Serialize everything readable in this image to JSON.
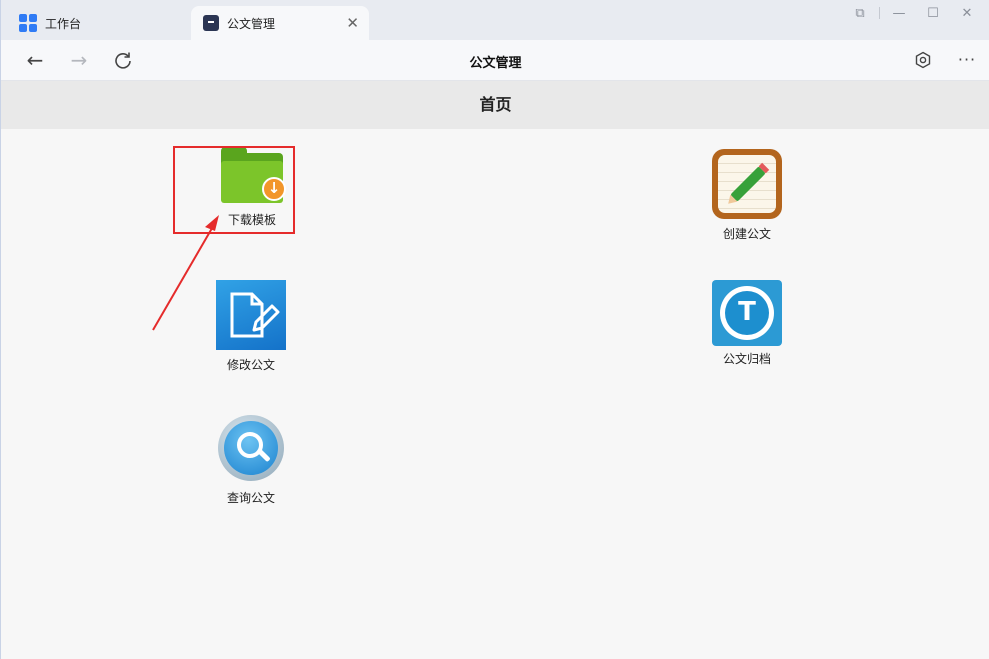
{
  "tabs": [
    {
      "label": "工作台",
      "icon": "workbench-grid-icon"
    },
    {
      "label": "公文管理",
      "icon": "document-app-icon",
      "active": true
    }
  ],
  "toolbar": {
    "title": "公文管理",
    "back_icon": "←",
    "forward_icon": "→",
    "reload_icon": "C",
    "more_icon": "···"
  },
  "page": {
    "header": "首页"
  },
  "apps": [
    {
      "key": "download",
      "label": "下载模板",
      "icon": "folder-download-icon"
    },
    {
      "key": "create",
      "label": "创建公文",
      "icon": "pencil-notebook-icon"
    },
    {
      "key": "edit",
      "label": "修改公文",
      "icon": "edit-document-icon"
    },
    {
      "key": "archive",
      "label": "公文归档",
      "icon": "archive-upload-icon"
    },
    {
      "key": "search",
      "label": "查询公文",
      "icon": "magnifier-icon"
    }
  ],
  "colors": {
    "annotation": "#e52b2b",
    "folder": "#7cc52a",
    "badge": "#f2962a"
  }
}
